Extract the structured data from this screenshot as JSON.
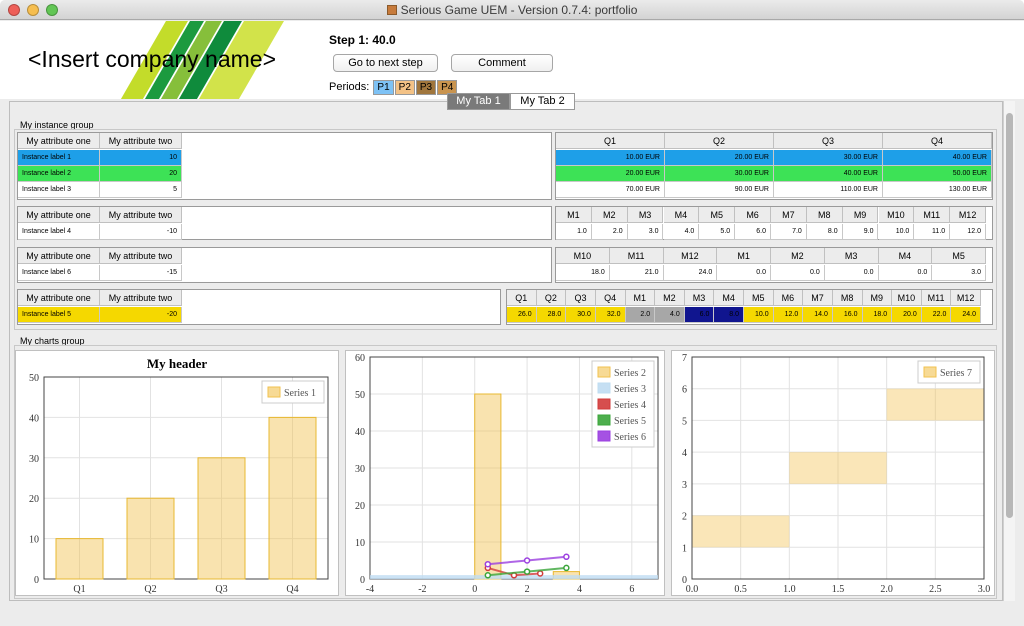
{
  "window": {
    "title": "Serious Game UEM - Version 0.7.4: portfolio"
  },
  "header": {
    "company": "<Insert company name>",
    "step": "Step 1: 40.0",
    "next_step_label": "Go to next step",
    "comment_label": "Comment",
    "periods_label": "Periods:",
    "periods": [
      {
        "label": "P1",
        "color": "#7ec2f5"
      },
      {
        "label": "P2",
        "color": "#f3c286"
      },
      {
        "label": "P3",
        "color": "#a0763d"
      },
      {
        "label": "P4",
        "color": "#c9944f"
      }
    ]
  },
  "tabs": [
    {
      "label": "My Tab 1",
      "active": true
    },
    {
      "label": "My Tab 2",
      "active": false
    }
  ],
  "instance_group": {
    "title": "My instance group",
    "attr_one": "My attribute one",
    "attr_two": "My attribute two",
    "table1": {
      "rows": [
        {
          "label": "Instance label 1",
          "value": "10",
          "color": "#1e9fe8"
        },
        {
          "label": "Instance label 2",
          "value": "20",
          "color": "#3de256"
        },
        {
          "label": "Instance label 3",
          "value": "5",
          "color": ""
        }
      ],
      "headers": [
        "Q1",
        "Q2",
        "Q3",
        "Q4"
      ],
      "values": [
        [
          "10.00 EUR",
          "20.00 EUR",
          "30.00 EUR",
          "40.00 EUR"
        ],
        [
          "20.00 EUR",
          "30.00 EUR",
          "40.00 EUR",
          "50.00 EUR"
        ],
        [
          "70.00 EUR",
          "90.00 EUR",
          "110.00 EUR",
          "130.00 EUR"
        ]
      ]
    },
    "table2": {
      "rows": [
        {
          "label": "Instance label 4",
          "value": "-10"
        }
      ],
      "headers": [
        "M1",
        "M2",
        "M3",
        "M4",
        "M5",
        "M6",
        "M7",
        "M8",
        "M9",
        "M10",
        "M11",
        "M12"
      ],
      "values": [
        "1.0",
        "2.0",
        "3.0",
        "4.0",
        "5.0",
        "6.0",
        "7.0",
        "8.0",
        "9.0",
        "10.0",
        "11.0",
        "12.0"
      ]
    },
    "table3": {
      "rows": [
        {
          "label": "Instance label 6",
          "value": "-15"
        }
      ],
      "headers": [
        "M10",
        "M11",
        "M12",
        "M1",
        "M2",
        "M3",
        "M4",
        "M5"
      ],
      "values": [
        "18.0",
        "21.0",
        "24.0",
        "0.0",
        "0.0",
        "0.0",
        "0.0",
        "3.0"
      ]
    },
    "table4": {
      "rows": [
        {
          "label": "Instance label 5",
          "value": "-20",
          "color": "#f5d800"
        }
      ],
      "headers": [
        "Q1",
        "Q2",
        "Q3",
        "Q4",
        "M1",
        "M2",
        "M3",
        "M4",
        "M5",
        "M6",
        "M7",
        "M8",
        "M9",
        "M10",
        "M11",
        "M12"
      ],
      "values": [
        "26.0",
        "28.0",
        "30.0",
        "32.0",
        "2.0",
        "4.0",
        "6.0",
        "8.0",
        "10.0",
        "12.0",
        "14.0",
        "16.0",
        "18.0",
        "20.0",
        "22.0",
        "24.0"
      ],
      "cell_colors": [
        "#f5d800",
        "#f5d800",
        "#f5d800",
        "#f5d800",
        "#a7a7a7",
        "#a7a7a7",
        "#10158f",
        "#10158f",
        "#f5d800",
        "#f5d800",
        "#f5d800",
        "#f5d800",
        "#f5d800",
        "#f5d800",
        "#f5d800",
        "#f5d800"
      ]
    }
  },
  "charts_group": {
    "title": "My charts group"
  },
  "chart_data": [
    {
      "type": "bar",
      "title": "My header",
      "categories": [
        "Q1",
        "Q2",
        "Q3",
        "Q4"
      ],
      "series": [
        {
          "name": "Series 1",
          "values": [
            10,
            20,
            30,
            40
          ],
          "color": "#f2c14e"
        }
      ],
      "ylim": [
        0,
        50
      ],
      "yticks": [
        0,
        10,
        20,
        30,
        40,
        50
      ],
      "legend": "top-right",
      "grid": true
    },
    {
      "type": "bar",
      "xlim": [
        -4,
        7
      ],
      "ylim": [
        0,
        60
      ],
      "xticks": [
        -4,
        -2,
        0,
        2,
        4,
        6
      ],
      "yticks": [
        0,
        10,
        20,
        30,
        40,
        50,
        60
      ],
      "legend": "top-right",
      "grid": true,
      "series": [
        {
          "name": "Series 2",
          "color": "#f2c14e",
          "kind": "bar",
          "bars": [
            {
              "x0": 0,
              "x1": 1,
              "y": 50
            },
            {
              "x0": 3,
              "x1": 4,
              "y": 2
            }
          ]
        },
        {
          "name": "Series 3",
          "color": "#bfdcf2",
          "kind": "line",
          "points": [
            [
              -4,
              0.5
            ],
            [
              7,
              0.5
            ]
          ]
        },
        {
          "name": "Series 4",
          "color": "#d23b3b",
          "kind": "line",
          "points": [
            [
              0.5,
              3
            ],
            [
              1.5,
              1
            ],
            [
              2.5,
              1.5
            ]
          ]
        },
        {
          "name": "Series 5",
          "color": "#3aa53a",
          "kind": "line",
          "points": [
            [
              0.5,
              1
            ],
            [
              2,
              2
            ],
            [
              3.5,
              3
            ]
          ]
        },
        {
          "name": "Series 6",
          "color": "#9b3fe0",
          "kind": "line",
          "points": [
            [
              0.5,
              4
            ],
            [
              2,
              5
            ],
            [
              3.5,
              6
            ]
          ]
        }
      ]
    },
    {
      "type": "bar",
      "xlim": [
        0,
        3
      ],
      "ylim": [
        0,
        7
      ],
      "xticks": [
        "0.0",
        "0.5",
        "1.0",
        "1.5",
        "2.0",
        "2.5",
        "3.0"
      ],
      "yticks": [
        0,
        1,
        2,
        3,
        4,
        5,
        6,
        7
      ],
      "legend": "top-right",
      "grid": true,
      "series": [
        {
          "name": "Series 7",
          "color": "#f2c14e",
          "boxes": [
            {
              "x0": 0,
              "x1": 1,
              "y0": 1,
              "y1": 2
            },
            {
              "x0": 1,
              "x1": 2,
              "y0": 3,
              "y1": 4
            },
            {
              "x0": 2,
              "x1": 3,
              "y0": 5,
              "y1": 6
            }
          ]
        }
      ]
    }
  ]
}
